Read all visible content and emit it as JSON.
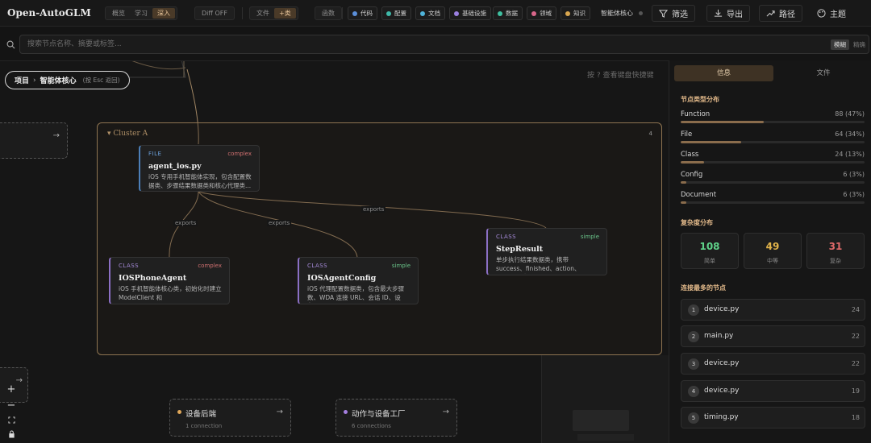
{
  "brand": "Open-AutoGLM",
  "view_modes": [
    "概览",
    "学习",
    "深入"
  ],
  "diff_label": "Diff OFF",
  "granularity": [
    "文件",
    "+类"
  ],
  "func_label": "函数",
  "categories": [
    {
      "label": "代码",
      "color": "#5b8fd9"
    },
    {
      "label": "配置",
      "color": "#3fb8a8"
    },
    {
      "label": "文档",
      "color": "#4fb3d9"
    },
    {
      "label": "基础设施",
      "color": "#9a7fe0"
    },
    {
      "label": "数据",
      "color": "#3fc0a0"
    },
    {
      "label": "领域",
      "color": "#d9668a"
    },
    {
      "label": "知识",
      "color": "#d9a64f"
    }
  ],
  "context_label": "智能体核心",
  "filter_label": "筛选",
  "export_label": "导出",
  "path_label": "路径",
  "theme_label": "主题",
  "search": {
    "placeholder": "搜索节点名称、摘要或标签...",
    "mode": "模糊",
    "mode_note": "精确"
  },
  "breadcrumb": {
    "root": "项目",
    "current": "智能体核心",
    "hint": "(按 Esc 返回)"
  },
  "keyboard_hint": "按 ? 查看键盘快捷键",
  "cluster": {
    "label": "Cluster A",
    "count": "4"
  },
  "nodes": [
    {
      "kind": "FILE",
      "complexity": "complex",
      "name": "agent_ios.py",
      "desc": "iOS 专用手机智能体实现，包含配置数据类、步骤结果数据类和核心代理类..."
    },
    {
      "kind": "CLASS",
      "complexity": "complex",
      "name": "IOSPhoneAgent",
      "desc": "iOS 手机智能体核心类，初始化时建立 ModelClient 和 XCTestConnection..."
    },
    {
      "kind": "CLASS",
      "complexity": "simple",
      "name": "IOSAgentConfig",
      "desc": "iOS 代理配置数据类，包含最大步骤数、WDA 连接 URL、会话 ID、设备..."
    },
    {
      "kind": "CLASS",
      "complexity": "simple",
      "name": "StepResult",
      "desc": "单步执行结果数据类，携带 success、finished、action、thinking 和..."
    }
  ],
  "edge_labels": [
    "exports",
    "exports",
    "exports"
  ],
  "groups": [
    {
      "title": "设备后端",
      "sub": "1 connection",
      "color": "#e0a85a"
    },
    {
      "title": "动作与设备工厂",
      "sub": "6 connections",
      "color": "#a57fe0"
    }
  ],
  "zoom": {
    "in": "+",
    "out": "−"
  },
  "panel": {
    "tabs": [
      "信息",
      "文件"
    ],
    "type_title": "节点类型分布",
    "types": [
      {
        "label": "Function",
        "value": "88 (47%)",
        "pct": 47
      },
      {
        "label": "File",
        "value": "64 (34%)",
        "pct": 34
      },
      {
        "label": "Class",
        "value": "24 (13%)",
        "pct": 13
      },
      {
        "label": "Config",
        "value": "6 (3%)",
        "pct": 3
      },
      {
        "label": "Document",
        "value": "6 (3%)",
        "pct": 3
      }
    ],
    "complexity_title": "复杂度分布",
    "complexity": [
      {
        "n": "108",
        "label": "简单",
        "color": "#5fd38a"
      },
      {
        "n": "49",
        "label": "中等",
        "color": "#e2b44a"
      },
      {
        "n": "31",
        "label": "复杂",
        "color": "#e06a6a"
      }
    ],
    "connected_title": "连接最多的节点",
    "connected": [
      {
        "rank": "1",
        "file": "device.py",
        "count": "24"
      },
      {
        "rank": "2",
        "file": "main.py",
        "count": "22"
      },
      {
        "rank": "3",
        "file": "device.py",
        "count": "22"
      },
      {
        "rank": "4",
        "file": "device.py",
        "count": "19"
      },
      {
        "rank": "5",
        "file": "timing.py",
        "count": "18"
      }
    ]
  }
}
